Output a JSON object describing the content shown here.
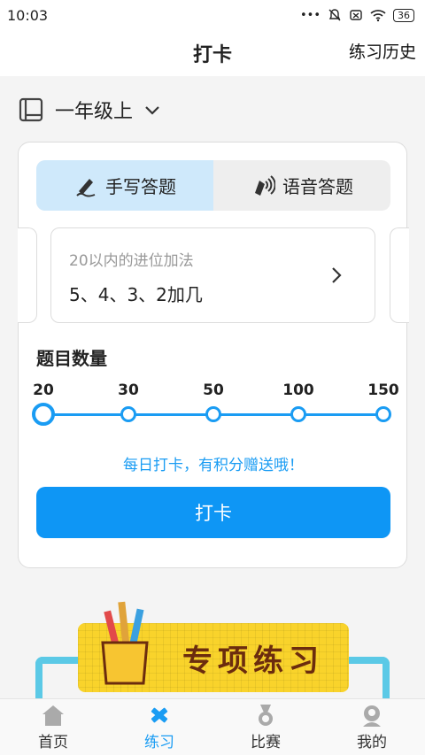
{
  "status_bar": {
    "time": "10:03",
    "battery": "36"
  },
  "header": {
    "title": "打卡",
    "history_label": "练习历史"
  },
  "grade": {
    "label": "一年级上"
  },
  "mode_tabs": [
    {
      "label": "手写答题",
      "icon": "handwrite-icon",
      "active": true
    },
    {
      "label": "语音答题",
      "icon": "voice-icon",
      "active": false
    }
  ],
  "topic": {
    "title": "20以内的进位加法",
    "subtitle": "5、4、3、2加几"
  },
  "question_count": {
    "label": "题目数量",
    "options": [
      "20",
      "30",
      "50",
      "100",
      "150"
    ],
    "selected": "20"
  },
  "promo_text": "每日打卡，有积分赠送哦！",
  "checkin_button": "打卡",
  "special_practice": {
    "label": "专项练习"
  },
  "bottom_nav": [
    {
      "label": "首页",
      "icon": "home-icon",
      "active": false
    },
    {
      "label": "练习",
      "icon": "practice-icon",
      "active": true
    },
    {
      "label": "比赛",
      "icon": "medal-icon",
      "active": false
    },
    {
      "label": "我的",
      "icon": "profile-icon",
      "active": false
    }
  ],
  "colors": {
    "accent": "#1a9cf3",
    "tab_active_bg": "#cfe9fb",
    "banner_yellow": "#f9d32b"
  }
}
